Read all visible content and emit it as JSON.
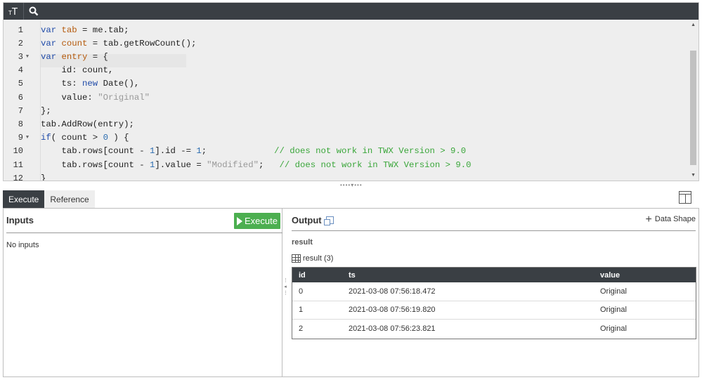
{
  "toolbar": {
    "font_icon": "font-size-icon",
    "search_icon": "search-icon"
  },
  "editor": {
    "lines": [
      {
        "num": "1",
        "fold": false
      },
      {
        "num": "2",
        "fold": false
      },
      {
        "num": "3",
        "fold": true
      },
      {
        "num": "4",
        "fold": false
      },
      {
        "num": "5",
        "fold": false
      },
      {
        "num": "6",
        "fold": false
      },
      {
        "num": "7",
        "fold": false
      },
      {
        "num": "8",
        "fold": false
      },
      {
        "num": "9",
        "fold": true
      },
      {
        "num": "10",
        "fold": false
      },
      {
        "num": "11",
        "fold": false
      },
      {
        "num": "12",
        "fold": false
      }
    ],
    "code": {
      "l1": [
        "var",
        " tab",
        " = me.tab;"
      ],
      "l2": [
        "var",
        " count",
        " = tab.getRowCount();"
      ],
      "l3": [
        "var",
        " entry",
        " = {"
      ],
      "l4": "    id: count,",
      "l5a": "    ts: ",
      "l5b": "new",
      "l5c": " Date(),",
      "l6a": "    value: ",
      "l6b": "\"Original\"",
      "l7": "};",
      "l8": "tab.AddRow(entry);",
      "l9a": "if",
      "l9b": "( count > ",
      "l9c": "0",
      "l9d": " ) {",
      "l10a": "    tab.rows[count - ",
      "l10b": "1",
      "l10c": "].id -= ",
      "l10d": "1",
      "l10e": ";             ",
      "l10f": "// does not work in TWX Version > 9.0",
      "l11a": "    tab.rows[count - ",
      "l11b": "1",
      "l11c": "].value = ",
      "l11d": "\"Modified\"",
      "l11e": ";   ",
      "l11f": "// does not work in TWX Version > 9.0",
      "l12": "}"
    }
  },
  "tabs": [
    {
      "label": "Execute",
      "active": true
    },
    {
      "label": "Reference",
      "active": false
    }
  ],
  "inputs": {
    "title": "Inputs",
    "execute_label": "Execute",
    "empty_text": "No inputs"
  },
  "output": {
    "title": "Output",
    "data_shape_label": "Data Shape",
    "result_label": "result",
    "result_caption": "result (3)",
    "columns": [
      "id",
      "ts",
      "value"
    ],
    "rows": [
      [
        "0",
        "2021-03-08 07:56:18.472",
        "Original"
      ],
      [
        "1",
        "2021-03-08 07:56:19.820",
        "Original"
      ],
      [
        "2",
        "2021-03-08 07:56:23.821",
        "Original"
      ]
    ]
  },
  "colors": {
    "accent_dark": "#3a3f44",
    "execute_green": "#4caf50",
    "keyword": "#1f4aa8",
    "comment": "#3aa63a",
    "string": "#999999"
  }
}
